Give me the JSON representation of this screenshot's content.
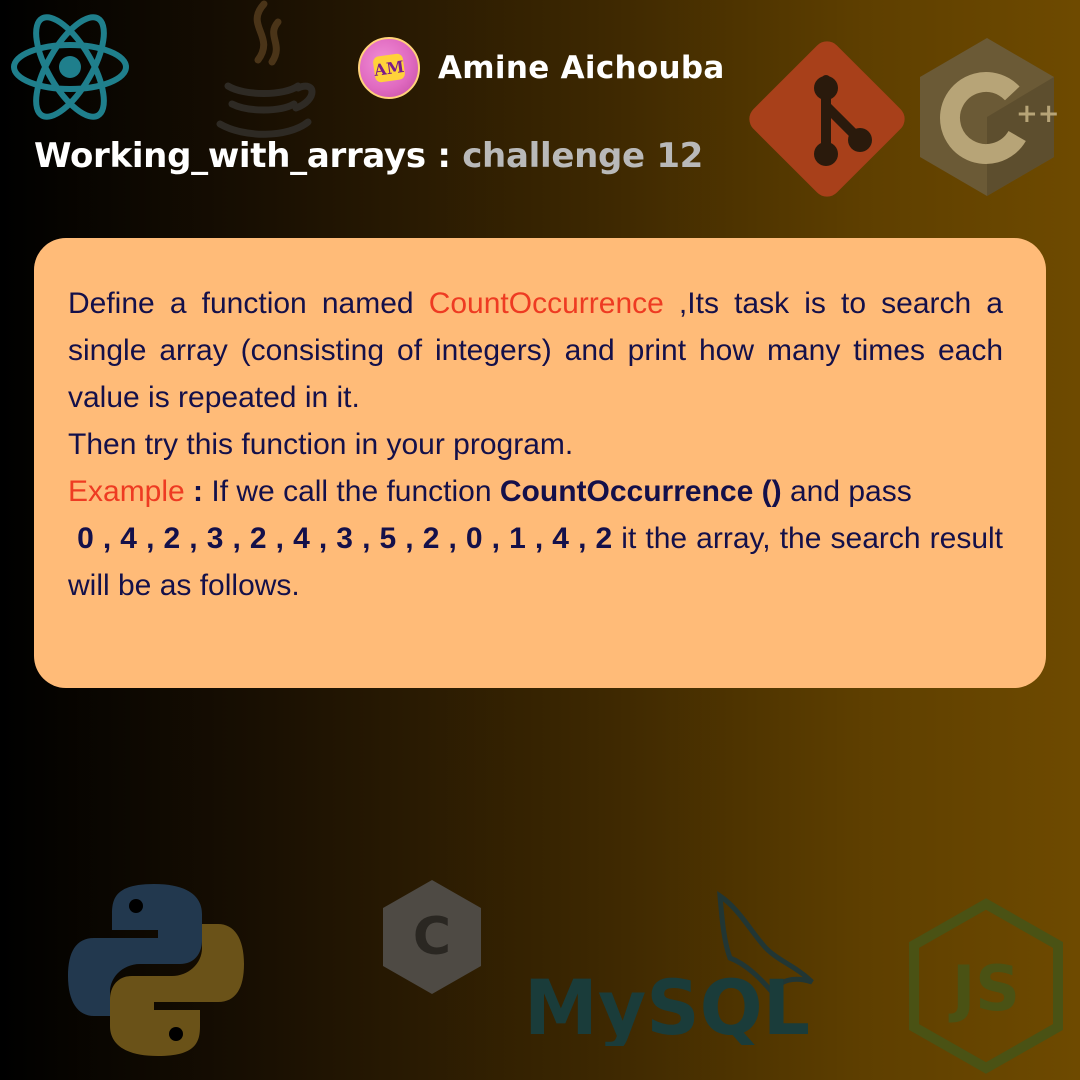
{
  "author": {
    "name": "Amine Aichouba",
    "avatar_text": "AM"
  },
  "title": {
    "main": "Working_with_arrays",
    "separator": " : ",
    "sub": "challenge 12"
  },
  "problem": {
    "p1_before": "Define a function named ",
    "function_name": "CountOccurrence",
    "p1_after": " ,Its task is to search a single array (consisting of integers) and print how many times each value is repeated in it.",
    "p2": "Then try this function in your program.",
    "example_label": "Example",
    "example_colon": " : ",
    "example_text_1": "If we call the function ",
    "example_function": "CountOccurrence ()",
    "example_text_2": " and pass",
    "example_numbers": " 0 , 4 , 2 , 3 , 2 , 4 , 3 , 5 , 2 , 0 , 1 , 4 , 2",
    "example_text_3": " it the array, the search result will be as follows."
  },
  "icons": [
    "react-icon",
    "java-icon",
    "git-icon",
    "cpp-icon",
    "python-icon",
    "c-icon",
    "mysql-icon",
    "nodejs-icon"
  ],
  "decor_labels": {
    "cpp_plus": "++",
    "c_letter": "C",
    "mysql_text": "MySQL",
    "js_text": "JS"
  },
  "colors": {
    "card_bg": "#ffbb78",
    "card_text": "#14104a",
    "accent_red": "#ee3b22",
    "title_sub": "#b9b9b9",
    "react": "#1f7f8c",
    "git": "#a8401a",
    "cpp": "#6b5a36",
    "python_blue": "#22384e",
    "python_yellow": "#6a5218",
    "c": "#4e4a44",
    "mysql": "#1a3c3a",
    "nodejs": "#4a5214"
  }
}
